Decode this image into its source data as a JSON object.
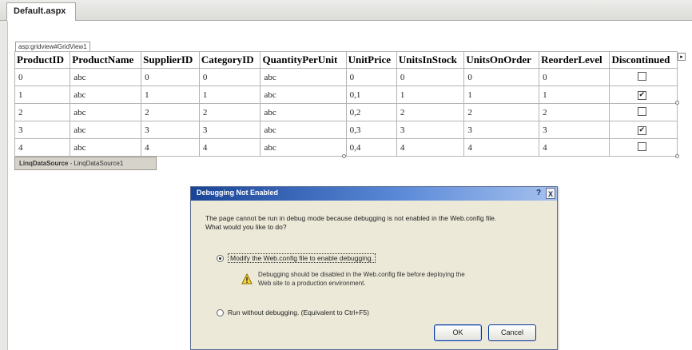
{
  "document_tab": {
    "label": "Default.aspx"
  },
  "gridview": {
    "tag": "asp:gridview#GridView1",
    "headers": [
      "ProductID",
      "ProductName",
      "SupplierID",
      "CategoryID",
      "QuantityPerUnit",
      "UnitPrice",
      "UnitsInStock",
      "UnitsOnOrder",
      "ReorderLevel",
      "Discontinued"
    ],
    "rows": [
      {
        "cells": [
          "0",
          "abc",
          "0",
          "0",
          "abc",
          "0",
          "0",
          "0",
          "0"
        ],
        "discontinued": false
      },
      {
        "cells": [
          "1",
          "abc",
          "1",
          "1",
          "abc",
          "0,1",
          "1",
          "1",
          "1"
        ],
        "discontinued": true
      },
      {
        "cells": [
          "2",
          "abc",
          "2",
          "2",
          "abc",
          "0,2",
          "2",
          "2",
          "2"
        ],
        "discontinued": false
      },
      {
        "cells": [
          "3",
          "abc",
          "3",
          "3",
          "abc",
          "0,3",
          "3",
          "3",
          "3"
        ],
        "discontinued": true
      },
      {
        "cells": [
          "4",
          "abc",
          "4",
          "4",
          "abc",
          "0,4",
          "4",
          "4",
          "4"
        ],
        "discontinued": false
      }
    ]
  },
  "datasource": {
    "type": "LinqDataSource",
    "id": " - LinqDataSource1"
  },
  "dialog": {
    "title": "Debugging Not Enabled",
    "help": "?",
    "close": "X",
    "message_line1": "The page cannot be run in debug mode because debugging is not enabled in the Web.config file.",
    "message_line2": "What would you like to do?",
    "option1": "Modify the Web.config file to enable debugging.",
    "option1_selected": true,
    "note_line1": "Debugging should be disabled in the Web.config file before deploying the",
    "note_line2": "Web site to a production environment.",
    "option2": "Run without debugging. (Equivalent to Ctrl+F5)",
    "option2_selected": false,
    "ok_label": "OK",
    "cancel_label": "Cancel"
  }
}
